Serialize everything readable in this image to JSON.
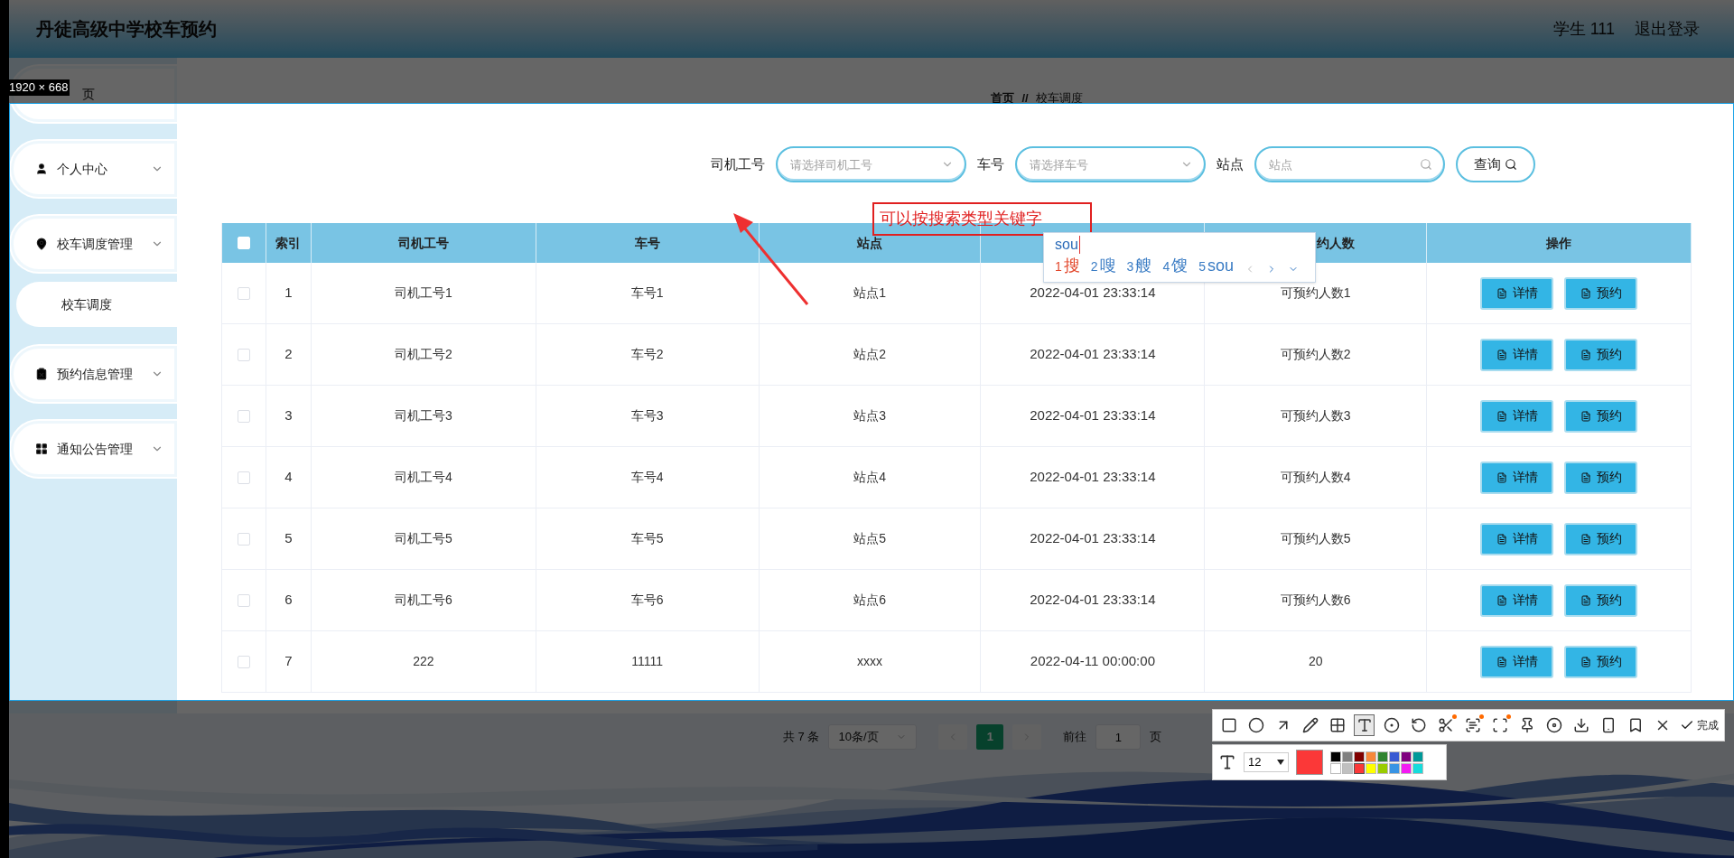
{
  "header": {
    "title": "丹徒高级中学校车预约",
    "user": "学生 111",
    "logout": "退出登录"
  },
  "size_label": "1920 × 668",
  "sidebar": {
    "items": [
      {
        "label": "页"
      },
      {
        "label": "个人中心"
      },
      {
        "label": "校车调度管理",
        "children": [
          {
            "label": "校车调度"
          }
        ]
      },
      {
        "label": "预约信息管理"
      },
      {
        "label": "通知公告管理"
      }
    ]
  },
  "breadcrumb": {
    "home": "首页",
    "separator": "//",
    "current": "校车调度"
  },
  "search": {
    "fields": [
      {
        "label": "司机工号",
        "kind": "select",
        "placeholder": "请选择司机工号"
      },
      {
        "label": "车号",
        "kind": "select",
        "placeholder": "请选择车号"
      },
      {
        "label": "站点",
        "kind": "input",
        "placeholder": "站点"
      }
    ],
    "button": "查询"
  },
  "annotation": {
    "text": "可以按搜索类型关键字"
  },
  "ime": {
    "composition": "sou",
    "candidates": [
      {
        "index": "1",
        "text": "搜",
        "selected": true
      },
      {
        "index": "2",
        "text": "嗖",
        "selected": false
      },
      {
        "index": "3",
        "text": "艘",
        "selected": false
      },
      {
        "index": "4",
        "text": "馊",
        "selected": false
      },
      {
        "index": "5",
        "text": "sou",
        "selected": false
      }
    ]
  },
  "table": {
    "select_all": {
      "checked": false
    },
    "columns": [
      {
        "label": "索引"
      },
      {
        "label": "司机工号"
      },
      {
        "label": "车号"
      },
      {
        "label": "站点"
      },
      {},
      {
        "label": "约人数"
      },
      {
        "label": "操作"
      }
    ],
    "rows": [
      {
        "checked": false,
        "cells": [
          "1",
          "司机工号1",
          "车号1",
          "站点1",
          "2022-04-01 23:33:14",
          "可预约人数1"
        ],
        "actions": [
          "详情",
          "预约"
        ]
      },
      {
        "checked": false,
        "cells": [
          "2",
          "司机工号2",
          "车号2",
          "站点2",
          "2022-04-01 23:33:14",
          "可预约人数2"
        ],
        "actions": [
          "详情",
          "预约"
        ]
      },
      {
        "checked": false,
        "cells": [
          "3",
          "司机工号3",
          "车号3",
          "站点3",
          "2022-04-01 23:33:14",
          "可预约人数3"
        ],
        "actions": [
          "详情",
          "预约"
        ]
      },
      {
        "checked": false,
        "cells": [
          "4",
          "司机工号4",
          "车号4",
          "站点4",
          "2022-04-01 23:33:14",
          "可预约人数4"
        ],
        "actions": [
          "详情",
          "预约"
        ]
      },
      {
        "checked": false,
        "cells": [
          "5",
          "司机工号5",
          "车号5",
          "站点5",
          "2022-04-01 23:33:14",
          "可预约人数5"
        ],
        "actions": [
          "详情",
          "预约"
        ]
      },
      {
        "checked": false,
        "cells": [
          "6",
          "司机工号6",
          "车号6",
          "站点6",
          "2022-04-01 23:33:14",
          "可预约人数6"
        ],
        "actions": [
          "详情",
          "预约"
        ]
      },
      {
        "checked": false,
        "cells": [
          "7",
          "222",
          "11111",
          "xxxx",
          "2022-04-11 00:00:00",
          "20"
        ],
        "actions": [
          "详情",
          "预约"
        ]
      }
    ]
  },
  "pagination": {
    "total": "共 7 条",
    "page_size": "10条/页",
    "pages": [
      {
        "label": "1",
        "selected": true
      }
    ],
    "goto_label": "前往",
    "goto_value": "1",
    "goto_suffix": "页"
  },
  "capture_toolbar": {
    "tools": [
      {
        "kind": "rect",
        "selected": false,
        "badge": false
      },
      {
        "kind": "ellipse",
        "selected": false,
        "badge": false
      },
      {
        "kind": "arrow",
        "selected": false,
        "badge": false
      },
      {
        "kind": "pencil",
        "selected": false,
        "badge": false
      },
      {
        "kind": "mosaic",
        "selected": false,
        "badge": false
      },
      {
        "kind": "text",
        "selected": true,
        "badge": false
      },
      {
        "kind": "number",
        "selected": false,
        "badge": false
      },
      {
        "kind": "undo",
        "selected": false,
        "badge": false
      },
      {
        "kind": "cut",
        "selected": false,
        "badge": true
      },
      {
        "kind": "ocr",
        "selected": false,
        "badge": true
      },
      {
        "kind": "scan",
        "selected": false,
        "badge": true
      },
      {
        "kind": "pin",
        "selected": false,
        "badge": false
      },
      {
        "kind": "record",
        "selected": false,
        "badge": false
      },
      {
        "kind": "download",
        "selected": false,
        "badge": false
      },
      {
        "kind": "phone",
        "selected": false,
        "badge": false
      },
      {
        "kind": "bookmark",
        "selected": false,
        "badge": false
      },
      {
        "kind": "close",
        "selected": false,
        "badge": false
      }
    ],
    "done": "完成",
    "font_size": "12",
    "palette": [
      {
        "color": "#000000",
        "selected": false
      },
      {
        "color": "#808080",
        "selected": false
      },
      {
        "color": "#800000",
        "selected": false
      },
      {
        "color": "#f7883a",
        "selected": false
      },
      {
        "color": "#308430",
        "selected": false
      },
      {
        "color": "#385ad3",
        "selected": false
      },
      {
        "color": "#800080",
        "selected": false
      },
      {
        "color": "#009999",
        "selected": false
      },
      {
        "color": "#ffffff",
        "selected": false
      },
      {
        "color": "#c0c0c0",
        "selected": false
      },
      {
        "color": "#fb3838",
        "selected": true
      },
      {
        "color": "#ffff00",
        "selected": false
      },
      {
        "color": "#99cc00",
        "selected": false
      },
      {
        "color": "#3894e4",
        "selected": false
      },
      {
        "color": "#f31bf3",
        "selected": false
      },
      {
        "color": "#16dcdc",
        "selected": false
      }
    ]
  }
}
